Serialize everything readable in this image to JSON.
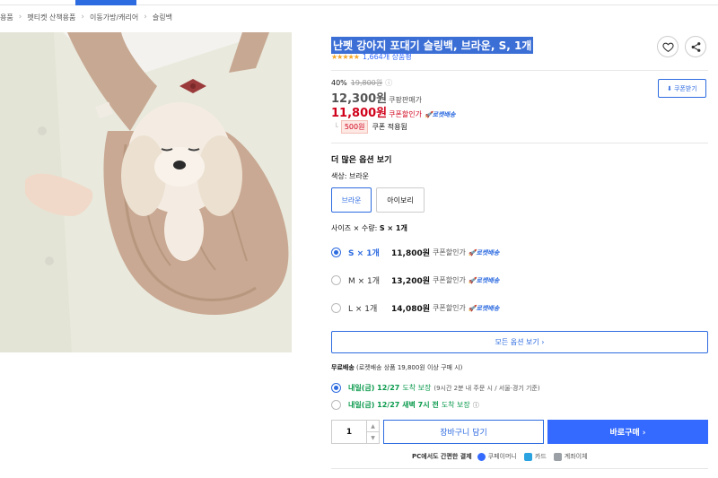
{
  "breadcrumb": [
    "용품",
    "펫티켓 산책용품",
    "이동가방/캐리어",
    "슬링백"
  ],
  "product": {
    "title": "난펫 강아지 포대기 슬링백, 브라운, S, 1개",
    "stars": "★★★★★",
    "rating_fraction": 0.9,
    "review_count": "1,664개 상품평"
  },
  "pricing": {
    "discount_rate": "40%",
    "original_price": "19,800원",
    "info_icon": "ⓘ",
    "sale_price": "12,300원",
    "sale_label": "쿠팡판매가",
    "coupon_price": "11,800원",
    "coupon_label": "쿠폰할인가",
    "rocket_label": "로켓배송",
    "coupon_amount": "500원",
    "coupon_applied_label": "쿠폰 적용됨",
    "coupon_button": "쿠폰받기"
  },
  "options": {
    "section_title": "더 많은 옵션 보기",
    "color_label": "색상: 브라운",
    "colors": [
      "브라운",
      "아이보리"
    ],
    "size_label_prefix": "사이즈 × 수량:",
    "size_label_value": "S × 1개",
    "sizes": [
      {
        "name": "S × 1개",
        "price": "11,800원",
        "coupon": "쿠폰할인가",
        "rocket": "로켓배송",
        "selected": true
      },
      {
        "name": "M × 1개",
        "price": "13,200원",
        "coupon": "쿠폰할인가",
        "rocket": "로켓배송",
        "selected": false
      },
      {
        "name": "L × 1개",
        "price": "14,080원",
        "coupon": "쿠폰할인가",
        "rocket": "로켓배송",
        "selected": false
      }
    ],
    "all_options_button": "모든 옵션 보기 ›"
  },
  "shipping": {
    "free_label": "무료배송",
    "free_note": "(로켓배송 상품 19,800원 이상 구매 시)",
    "options": [
      {
        "main": "내일(금) 12/27",
        "sub": "도착 보장",
        "note": "(9시간 2분 내 주문 시 / 서울·경기 기준)",
        "selected": true
      },
      {
        "main": "내일(금) 12/27 새벽 7시 전",
        "sub": "도착 보장",
        "note": "ⓘ",
        "selected": false
      }
    ]
  },
  "purchase": {
    "quantity": "1",
    "cart_button": "장바구니 담기",
    "buy_button": "바로구매 ›"
  },
  "payment": {
    "title": "PC에서도 간편한 결제",
    "methods": [
      {
        "label": "쿠페이머니",
        "icon": "coupay-icon",
        "color": "#346aff"
      },
      {
        "label": "카드",
        "icon": "card-icon",
        "color": "#2aa3e0"
      },
      {
        "label": "계좌이체",
        "icon": "bank-icon",
        "color": "#9aa0a6"
      }
    ]
  },
  "colors": {
    "accent": "#346aff",
    "sale_red": "#d0021b",
    "delivery_green": "#0a9a4c",
    "star": "#f5a623"
  }
}
